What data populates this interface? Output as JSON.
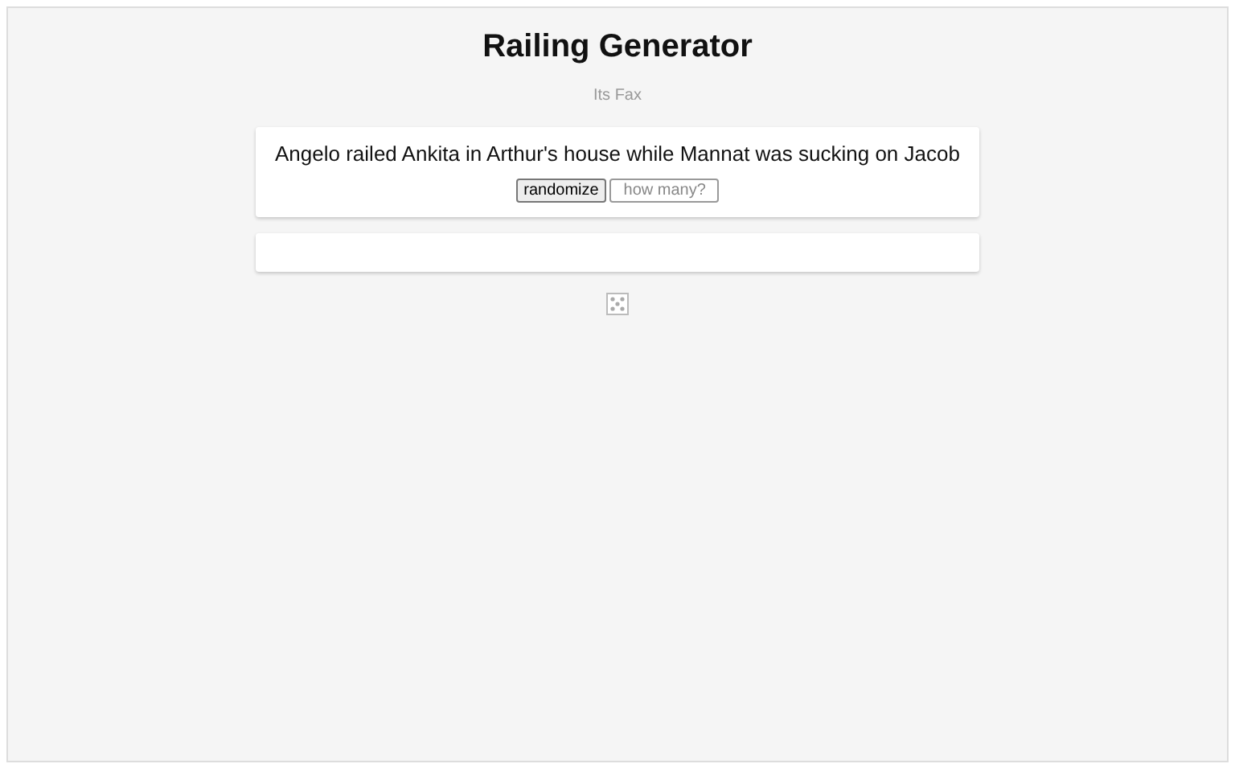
{
  "title": "Railing Generator",
  "subtitle": "Its Fax",
  "sentence": "Angelo railed Ankita in Arthur's house while Mannat was sucking on Jacob",
  "randomize_button": "randomize",
  "count_field": {
    "placeholder": "how many?"
  }
}
